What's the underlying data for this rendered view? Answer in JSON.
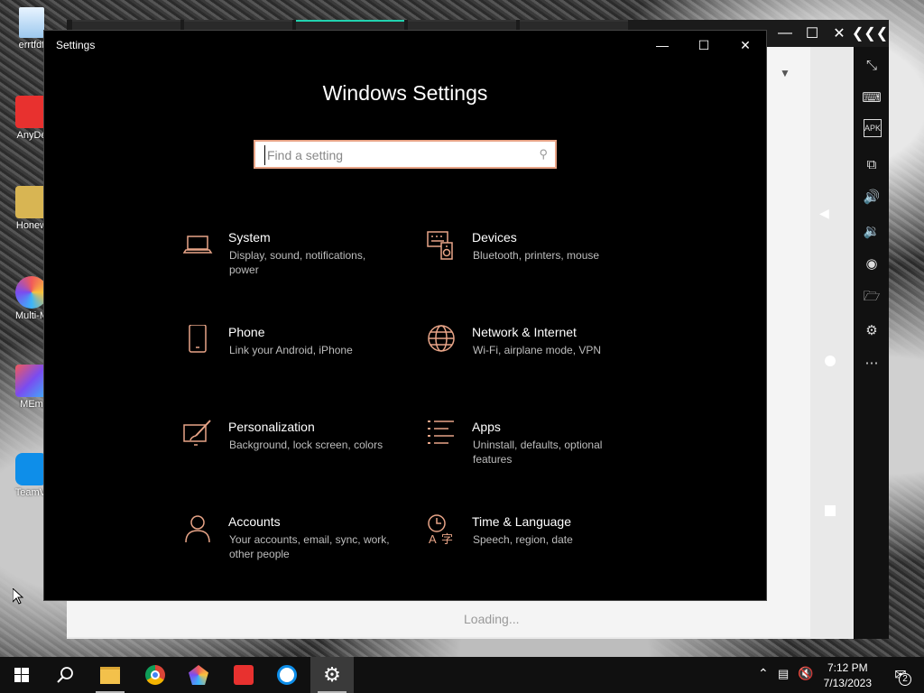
{
  "desktop": {
    "icons": [
      {
        "label": "errtfdf"
      },
      {
        "label": "AnyDe"
      },
      {
        "label": "Honew"
      },
      {
        "label": "Multi-M"
      },
      {
        "label": "MEm"
      },
      {
        "label": "TeamVi"
      }
    ]
  },
  "emulator": {
    "loading_text": "Loading..."
  },
  "settings": {
    "window_title": "Settings",
    "heading": "Windows Settings",
    "search_placeholder": "Find a setting",
    "accent": "#e8a487",
    "categories": [
      {
        "name": "System",
        "desc": "Display, sound, notifications, power",
        "icon": "laptop-icon"
      },
      {
        "name": "Devices",
        "desc": "Bluetooth, printers, mouse",
        "icon": "keyboard-speaker-icon"
      },
      {
        "name": "Phone",
        "desc": "Link your Android, iPhone",
        "icon": "phone-icon"
      },
      {
        "name": "Network & Internet",
        "desc": "Wi-Fi, airplane mode, VPN",
        "icon": "globe-icon"
      },
      {
        "name": "Personalization",
        "desc": "Background, lock screen, colors",
        "icon": "paint-icon"
      },
      {
        "name": "Apps",
        "desc": "Uninstall, defaults, optional features",
        "icon": "apps-list-icon"
      },
      {
        "name": "Accounts",
        "desc": "Your accounts, email, sync, work, other people",
        "icon": "person-icon"
      },
      {
        "name": "Time & Language",
        "desc": "Speech, region, date",
        "icon": "time-language-icon"
      }
    ]
  },
  "taskbar": {
    "time": "7:12 PM",
    "date": "7/13/2023",
    "notification_count": "2"
  }
}
